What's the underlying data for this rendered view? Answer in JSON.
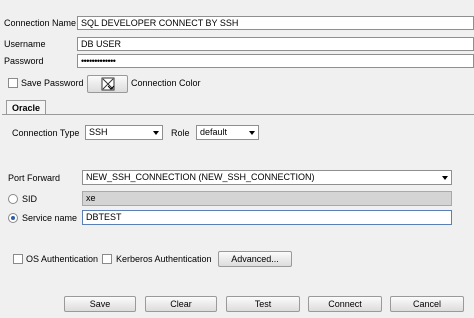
{
  "connection": {
    "name_label": "Connection Name",
    "name_value": "SQL DEVELOPER CONNECT BY SSH",
    "username_label": "Username",
    "username_value": "DB USER",
    "password_label": "Password",
    "password_value": "•••••••••••••",
    "save_password_label": "Save Password",
    "connection_color_label": "Connection Color"
  },
  "tabs": [
    {
      "label": "Oracle"
    }
  ],
  "oracle": {
    "connection_type_label": "Connection Type",
    "connection_type_value": "SSH",
    "role_label": "Role",
    "role_value": "default",
    "port_forward_label": "Port Forward",
    "port_forward_value": "NEW_SSH_CONNECTION (NEW_SSH_CONNECTION)",
    "sid_label": "SID",
    "sid_value": "xe",
    "service_name_label": "Service name",
    "service_name_value": "DBTEST",
    "os_auth_label": "OS Authentication",
    "kerberos_auth_label": "Kerberos Authentication",
    "advanced_label": "Advanced..."
  },
  "buttons": {
    "save": "Save",
    "clear": "Clear",
    "test": "Test",
    "connect": "Connect",
    "cancel": "Cancel"
  }
}
